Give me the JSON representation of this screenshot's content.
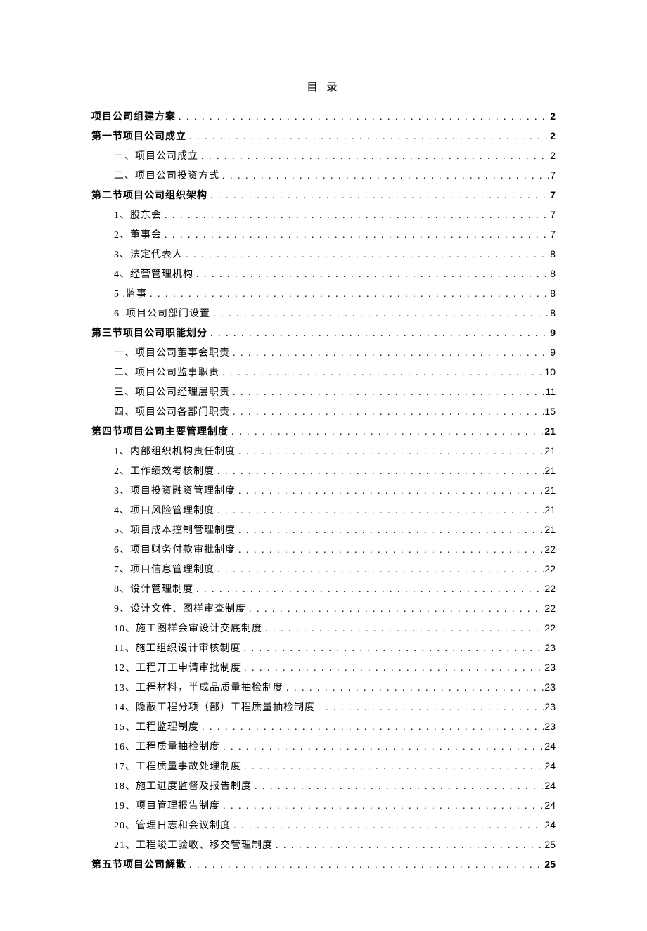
{
  "title": "目 录",
  "toc": [
    {
      "label": "项目公司组建方案",
      "page": "2",
      "indent": 0,
      "bold": true
    },
    {
      "label": "第一节项目公司成立",
      "page": "2",
      "indent": 0,
      "bold": true
    },
    {
      "label": "一、项目公司成立",
      "page": "2",
      "indent": 1,
      "bold": false
    },
    {
      "label": "二、项目公司投资方式",
      "page": "7",
      "indent": 1,
      "bold": false
    },
    {
      "label": "第二节项目公司组织架构",
      "page": "7",
      "indent": 0,
      "bold": true
    },
    {
      "label": "1、股东会",
      "page": "7",
      "indent": 1,
      "bold": false
    },
    {
      "label": "2、董事会",
      "page": "7",
      "indent": 1,
      "bold": false
    },
    {
      "label": "3、法定代表人",
      "page": "8",
      "indent": 1,
      "bold": false
    },
    {
      "label": "4、经营管理机构",
      "page": "8",
      "indent": 1,
      "bold": false
    },
    {
      "label": "5     .监事",
      "page": "8",
      "indent": 1,
      "bold": false
    },
    {
      "label": "6     .项目公司部门设置",
      "page": "8",
      "indent": 1,
      "bold": false
    },
    {
      "label": "第三节项目公司职能划分",
      "page": "9",
      "indent": 0,
      "bold": true
    },
    {
      "label": "一、项目公司董事会职责",
      "page": "9",
      "indent": 1,
      "bold": false
    },
    {
      "label": "二、项目公司监事职责",
      "page": "10",
      "indent": 1,
      "bold": false
    },
    {
      "label": "三、项目公司经理层职责",
      "page": "11",
      "indent": 1,
      "bold": false
    },
    {
      "label": "四、项目公司各部门职责",
      "page": "15",
      "indent": 1,
      "bold": false
    },
    {
      "label": "第四节项目公司主要管理制度",
      "page": "21",
      "indent": 0,
      "bold": true
    },
    {
      "label": "1、内部组织机构责任制度",
      "page": "21",
      "indent": 1,
      "bold": false
    },
    {
      "label": "2、工作绩效考核制度",
      "page": "21",
      "indent": 1,
      "bold": false
    },
    {
      "label": "3、项目投资融资管理制度",
      "page": "21",
      "indent": 1,
      "bold": false
    },
    {
      "label": "4、项目风险管理制度",
      "page": "21",
      "indent": 1,
      "bold": false
    },
    {
      "label": "5、项目成本控制管理制度",
      "page": "21",
      "indent": 1,
      "bold": false
    },
    {
      "label": "6、项目财务付款审批制度",
      "page": "22",
      "indent": 1,
      "bold": false
    },
    {
      "label": "7、项目信息管理制度",
      "page": "22",
      "indent": 1,
      "bold": false
    },
    {
      "label": "8、设计管理制度",
      "page": "22",
      "indent": 1,
      "bold": false
    },
    {
      "label": "9、设计文件、图样审查制度",
      "page": "22",
      "indent": 1,
      "bold": false
    },
    {
      "label": "10、施工图样会审设计交底制度",
      "page": "22",
      "indent": 1,
      "bold": false
    },
    {
      "label": "11、施工组织设计审核制度",
      "page": "23",
      "indent": 1,
      "bold": false
    },
    {
      "label": "12、工程开工申请审批制度",
      "page": "23",
      "indent": 1,
      "bold": false
    },
    {
      "label": "13、工程材料，半成品质量抽检制度",
      "page": "23",
      "indent": 1,
      "bold": false
    },
    {
      "label": "14、隐蔽工程分项（部）工程质量抽检制度",
      "page": "23",
      "indent": 1,
      "bold": false
    },
    {
      "label": "15、工程监理制度",
      "page": "23",
      "indent": 1,
      "bold": false
    },
    {
      "label": "16、工程质量抽检制度",
      "page": "24",
      "indent": 1,
      "bold": false
    },
    {
      "label": "17、工程质量事故处理制度",
      "page": "24",
      "indent": 1,
      "bold": false
    },
    {
      "label": "18、施工进度监督及报告制度",
      "page": "24",
      "indent": 1,
      "bold": false
    },
    {
      "label": "19、项目管理报告制度",
      "page": "24",
      "indent": 1,
      "bold": false
    },
    {
      "label": "20、管理日志和会议制度",
      "page": "24",
      "indent": 1,
      "bold": false
    },
    {
      "label": "21、工程竣工验收、移交管理制度",
      "page": "25",
      "indent": 1,
      "bold": false
    },
    {
      "label": "第五节项目公司解散",
      "page": "25",
      "indent": 0,
      "bold": true
    }
  ]
}
